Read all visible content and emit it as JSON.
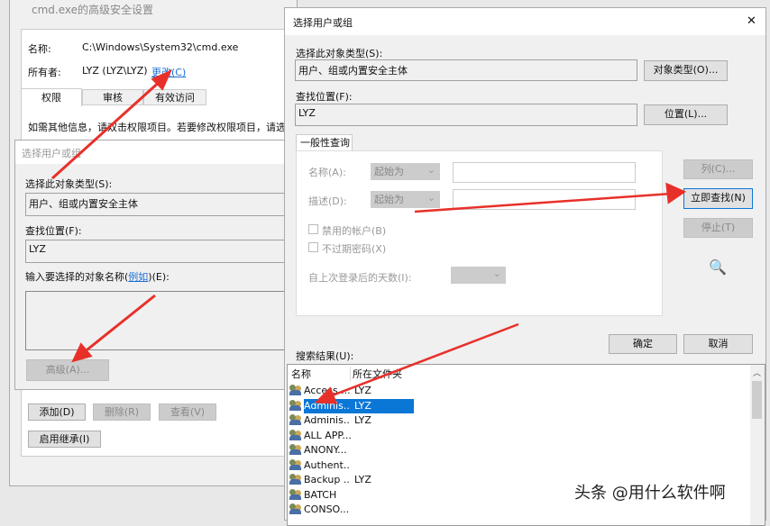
{
  "bg_window": {
    "title": "cmd.exe的高级安全设置",
    "name_label": "名称:",
    "name_value": "C:\\Windows\\System32\\cmd.exe",
    "owner_label": "所有者:",
    "owner_value": "LYZ (LYZ\\LYZ)",
    "change_link": "更改(C)",
    "tabs": [
      "权限",
      "审核",
      "有效访问"
    ],
    "info_text": "如需其他信息，请双击权限项目。若要修改权限项目，请选",
    "add": "添加(D)",
    "remove": "删除(R)",
    "view": "查看(V)",
    "enable_inherit": "启用继承(I)"
  },
  "small_dialog": {
    "title": "选择用户或组",
    "object_type_label": "选择此对象类型(S):",
    "object_type_value": "用户、组或内置安全主体",
    "location_label": "查找位置(F):",
    "location_value": "LYZ",
    "enter_label_pre": "输入要选择的对象名称(",
    "example_link": "例如",
    "enter_label_post": ")(E):",
    "advanced": "高级(A)..."
  },
  "dialog": {
    "title": "选择用户或组",
    "close": "✕",
    "object_type_label": "选择此对象类型(S):",
    "object_type_value": "用户、组或内置安全主体",
    "object_types_btn": "对象类型(O)...",
    "location_label": "查找位置(F):",
    "location_value": "LYZ",
    "location_btn": "位置(L)...",
    "tab": "一般性查询",
    "name_label": "名称(A):",
    "name_mode": "起始为",
    "desc_label": "描述(D):",
    "desc_mode": "起始为",
    "disabled_accounts": "禁用的帐户(B)",
    "no_expire": "不过期密码(X)",
    "days_label": "自上次登录后的天数(I):",
    "columns_btn": "列(C)...",
    "find_now_btn": "立即查找(N)",
    "stop_btn": "停止(T)",
    "ok": "确定",
    "cancel": "取消",
    "results_label": "搜索结果(U):",
    "col_name": "名称",
    "col_folder": "所在文件夹",
    "results": [
      {
        "name": "Access ...",
        "folder": "LYZ"
      },
      {
        "name": "Adminis...",
        "folder": "LYZ",
        "selected": true
      },
      {
        "name": "Adminis...",
        "folder": "LYZ"
      },
      {
        "name": "ALL APP...",
        "folder": ""
      },
      {
        "name": "ANONY...",
        "folder": ""
      },
      {
        "name": "Authent...",
        "folder": ""
      },
      {
        "name": "Backup ...",
        "folder": "LYZ"
      },
      {
        "name": "BATCH",
        "folder": ""
      },
      {
        "name": "CONSO...",
        "folder": ""
      }
    ]
  },
  "watermark": "头条 @用什么软件啊",
  "colors": {
    "accent": "#0a76d6",
    "arrow": "#e8302a"
  }
}
